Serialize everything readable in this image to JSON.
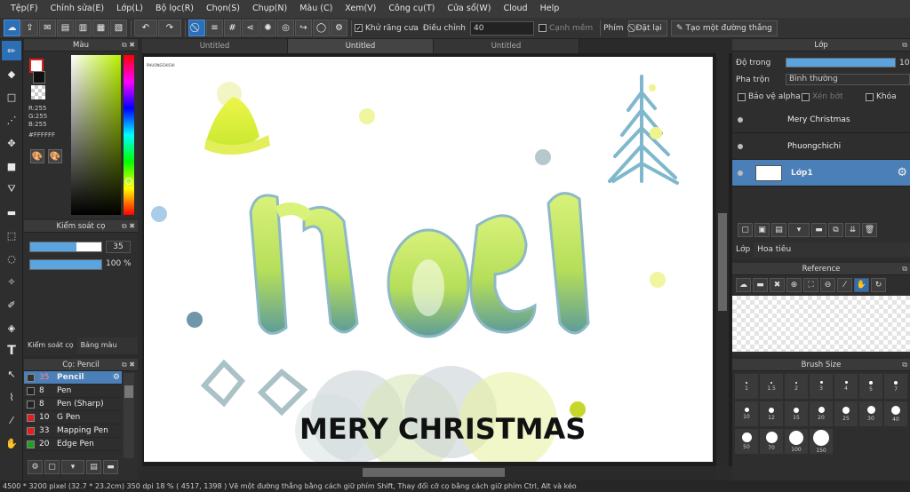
{
  "menu": [
    "Tệp(F)",
    "Chỉnh sửa(E)",
    "Lớp(L)",
    "Bộ lọc(R)",
    "Chọn(S)",
    "Chụp(N)",
    "Màu (C)",
    "Xem(V)",
    "Công cụ(T)",
    "Cửa sổ(W)",
    "Cloud",
    "Help"
  ],
  "toolbar": {
    "antialias_label": "Khử răng cưa",
    "adjust_label": "Điều chỉnh",
    "adjust_value": "40",
    "smooth_edge_label": "Cạnh mềm",
    "key_label": "Phím",
    "reset_label": "Đặt lại",
    "straight_line_label": "Tạo một đường thẳng"
  },
  "color_panel": {
    "title": "Màu",
    "r": "R:255",
    "g": "G:255",
    "b": "B:255",
    "hex": "#FFFFFF",
    "fg_color": "#ffffff"
  },
  "brush_control": {
    "title": "Kiểm soát cọ",
    "size": "35",
    "size_fraction": 0.65,
    "opacity": "100 %",
    "opacity_fraction": 1.0,
    "tab1": "Kiểm soát cọ",
    "tab2": "Bảng màu"
  },
  "brush_list": {
    "title": "Cọ: Pencil",
    "items": [
      {
        "size": "35",
        "name": "Pencil",
        "color": "#333333"
      },
      {
        "size": "8",
        "name": "Pen",
        "color": "#222222"
      },
      {
        "size": "8",
        "name": "Pen (Sharp)",
        "color": "#222222"
      },
      {
        "size": "10",
        "name": "G Pen",
        "color": "#e02020"
      },
      {
        "size": "33",
        "name": "Mapping Pen",
        "color": "#e02020"
      },
      {
        "size": "20",
        "name": "Edge Pen",
        "color": "#20a020"
      }
    ]
  },
  "tabs": [
    "Untitled",
    "Untitled",
    "Untitled"
  ],
  "canvas": {
    "watermark": "PHUONGCHICHI",
    "main_text": "MERY CHRISTMAS"
  },
  "layer_panel": {
    "title": "Lớp",
    "opacity_label": "Độ trong",
    "opacity_value": "100",
    "blend_label": "Pha trộn",
    "blend_value": "Bình thường",
    "protect_alpha": "Bảo vệ alpha",
    "clipping": "Xén bớt",
    "lock": "Khóa",
    "layers": [
      "Mery Christmas",
      "Phuongchichi",
      "Lớp1"
    ],
    "tab1": "Lớp",
    "tab2": "Hoa tiêu"
  },
  "reference": {
    "title": "Reference"
  },
  "brush_size": {
    "title": "Brush Size",
    "sizes": [
      "1",
      "1.5",
      "2",
      "3",
      "4",
      "5",
      "7",
      "10",
      "12",
      "15",
      "20",
      "25",
      "30",
      "40",
      "50",
      "70",
      "100",
      "150"
    ]
  },
  "status": "4500 * 3200 pixel  (32.7 * 23.2cm)  350 dpi  18 %  ( 4517, 1398 )  Vẽ một đường thẳng bằng cách giữ phím Shift, Thay đổi cỡ cọ bằng cách giữ phím Ctrl, Alt và kéo"
}
